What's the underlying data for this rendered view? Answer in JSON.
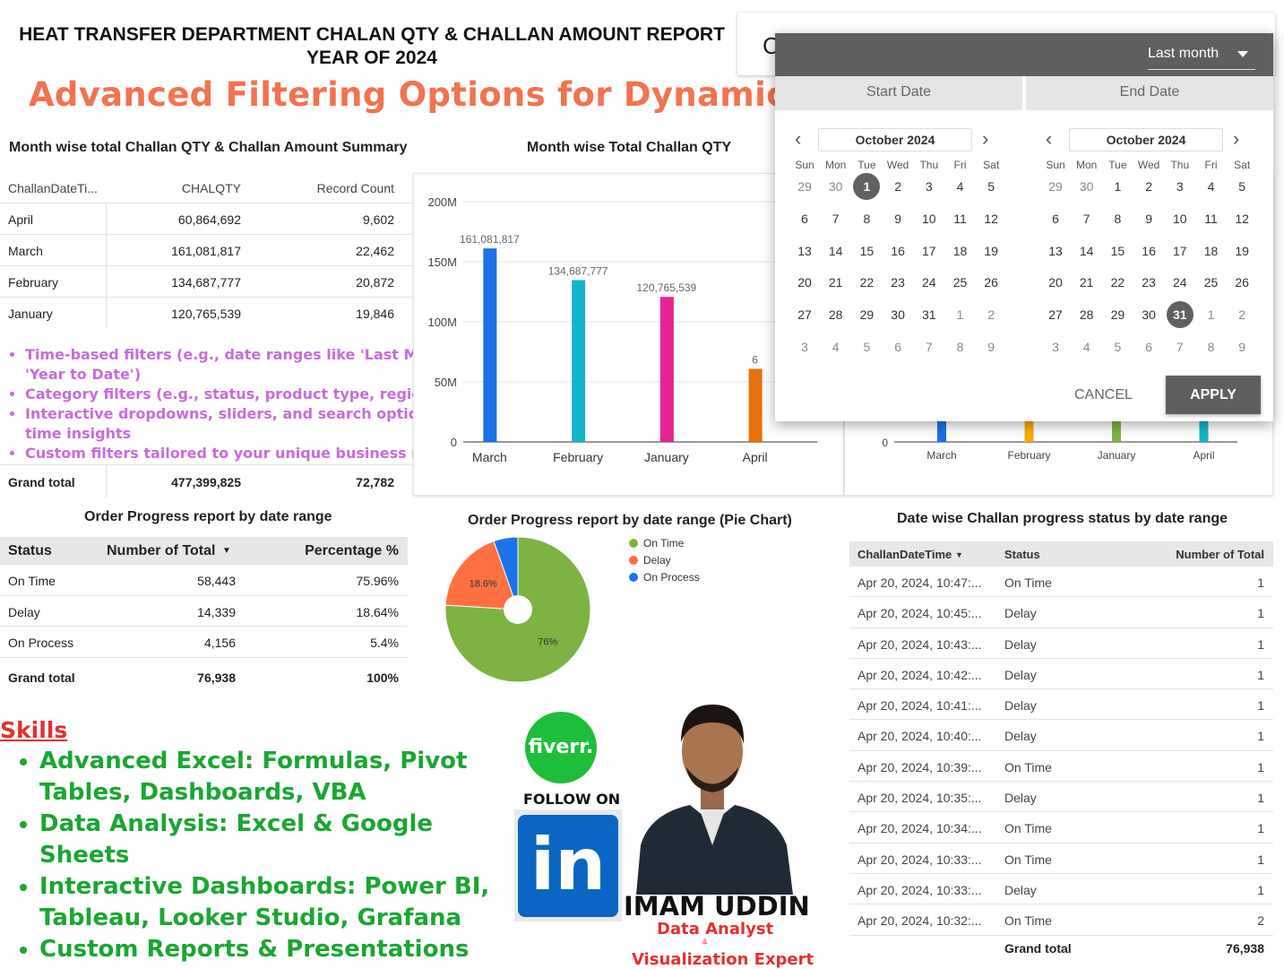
{
  "report": {
    "title_line1": "HEAT TRANSFER DEPARTMENT CHALAN QTY & CHALLAN AMOUNT REPORT",
    "title_line2": "YEAR OF 2024",
    "headline": "Advanced Filtering Options for Dynamic Reports"
  },
  "month_summary": {
    "title": "Month wise total Challan QTY & Challan Amount Summary",
    "columns": [
      "ChallanDateTi...",
      "CHALQTY",
      "Record Count"
    ],
    "rows": [
      [
        "April",
        "60,864,692",
        "9,602"
      ],
      [
        "March",
        "161,081,817",
        "22,462"
      ],
      [
        "February",
        "134,687,777",
        "20,872"
      ],
      [
        "January",
        "120,765,539",
        "19,846"
      ]
    ],
    "grand_label": "Grand total",
    "grand_qty": "477,399,825",
    "grand_count": "72,782"
  },
  "filter_bullets": [
    "Time-based filters (e.g., date ranges like 'Last Month', 'Year to Date')",
    "Category filters (e.g., status, product type, region)",
    "Interactive dropdowns, sliders, and search options for real-time insights",
    "Custom filters tailored to your unique business needs"
  ],
  "chart_data": [
    {
      "type": "bar",
      "title": "Month wise Total Challan QTY",
      "categories": [
        "March",
        "February",
        "January",
        "April"
      ],
      "values": [
        161081817,
        134687777,
        120765539,
        60864692
      ],
      "data_labels": [
        "161,081,817",
        "134,687,777",
        "120,765,539",
        "6"
      ],
      "colors": [
        "#1a73e8",
        "#12b5cb",
        "#e52592",
        "#e8710a"
      ],
      "ylim": [
        0,
        200000000
      ],
      "y_ticks": [
        "0",
        "50M",
        "100M",
        "150M",
        "200M"
      ],
      "grid": true
    },
    {
      "type": "bar",
      "categories": [
        "March",
        "February",
        "January",
        "April"
      ],
      "colors": [
        "#1a73e8",
        "#f9ab00",
        "#7cb342",
        "#12b5cb"
      ],
      "y_ticks": [
        "0"
      ]
    },
    {
      "type": "pie",
      "title": "Order Progress report by date range (Pie Chart)",
      "labels": [
        "On Time",
        "Delay",
        "On Process"
      ],
      "values": [
        75.96,
        18.64,
        5.4
      ],
      "data_labels": [
        "76%",
        "18.6%",
        ""
      ],
      "colors": [
        "#7cb342",
        "#ff7043",
        "#1a73e8"
      ],
      "legend": "right"
    }
  ],
  "order_progress": {
    "title": "Order Progress report by date range",
    "columns": [
      "Status",
      "Number of Total",
      "Percentage %"
    ],
    "rows": [
      [
        "On Time",
        "58,443",
        "75.96%"
      ],
      [
        "Delay",
        "14,339",
        "18.64%"
      ],
      [
        "On Process",
        "4,156",
        "5.4%"
      ]
    ],
    "grand_label": "Grand total",
    "grand_total": "76,938",
    "grand_pct": "100%"
  },
  "date_wise": {
    "title": "Date wise Challan progress status by date range",
    "columns": [
      "ChallanDateTime",
      "Status",
      "Number of Total"
    ],
    "rows": [
      [
        "Apr 20, 2024, 10:47:...",
        "On Time",
        "1"
      ],
      [
        "Apr 20, 2024, 10:45:...",
        "Delay",
        "1"
      ],
      [
        "Apr 20, 2024, 10:43:...",
        "Delay",
        "1"
      ],
      [
        "Apr 20, 2024, 10:42:...",
        "Delay",
        "1"
      ],
      [
        "Apr 20, 2024, 10:41:...",
        "Delay",
        "1"
      ],
      [
        "Apr 20, 2024, 10:40:...",
        "Delay",
        "1"
      ],
      [
        "Apr 20, 2024, 10:39:...",
        "On Time",
        "1"
      ],
      [
        "Apr 20, 2024, 10:35:...",
        "Delay",
        "1"
      ],
      [
        "Apr 20, 2024, 10:34:...",
        "On Time",
        "1"
      ],
      [
        "Apr 20, 2024, 10:33:...",
        "On Time",
        "1"
      ],
      [
        "Apr 20, 2024, 10:33:...",
        "Delay",
        "1"
      ],
      [
        "Apr 20, 2024, 10:32:...",
        "On Time",
        "2"
      ]
    ],
    "grand_label": "Grand total",
    "grand_total": "76,938"
  },
  "skills": {
    "title": "Skills",
    "items": [
      "Advanced Excel: Formulas, Pivot Tables, Dashboards, VBA",
      "Data Analysis: Excel & Google Sheets",
      "Interactive Dashboards: Power BI, Tableau, Looker Studio, Grafana",
      "Custom Reports & Presentations"
    ]
  },
  "branding": {
    "fiverr": "fiverr.",
    "follow": "FOLLOW ON",
    "linkedin": "in",
    "name": "IMAM UDDIN",
    "role1": "Data Analyst",
    "amp": "&",
    "role2": "Visualization Expert"
  },
  "date_picker": {
    "behind_letter": "C",
    "range": "Last month",
    "start_tab": "Start Date",
    "end_tab": "End Date",
    "weekdays": [
      "Sun",
      "Mon",
      "Tue",
      "Wed",
      "Thu",
      "Fri",
      "Sat"
    ],
    "left": {
      "month": "October 2024",
      "days": [
        "29",
        "30",
        "1",
        "2",
        "3",
        "4",
        "5",
        "6",
        "7",
        "8",
        "9",
        "10",
        "11",
        "12",
        "13",
        "14",
        "15",
        "16",
        "17",
        "18",
        "19",
        "20",
        "21",
        "22",
        "23",
        "24",
        "25",
        "26",
        "27",
        "28",
        "29",
        "30",
        "31",
        "1",
        "2",
        "3",
        "4",
        "5",
        "6",
        "7",
        "8",
        "9"
      ],
      "selected": "1"
    },
    "right": {
      "month": "October 2024",
      "days": [
        "29",
        "30",
        "1",
        "2",
        "3",
        "4",
        "5",
        "6",
        "7",
        "8",
        "9",
        "10",
        "11",
        "12",
        "13",
        "14",
        "15",
        "16",
        "17",
        "18",
        "19",
        "20",
        "21",
        "22",
        "23",
        "24",
        "25",
        "26",
        "27",
        "28",
        "29",
        "30",
        "31",
        "1",
        "2",
        "3",
        "4",
        "5",
        "6",
        "7",
        "8",
        "9"
      ],
      "selected": "31"
    },
    "cancel": "CANCEL",
    "apply": "APPLY"
  }
}
